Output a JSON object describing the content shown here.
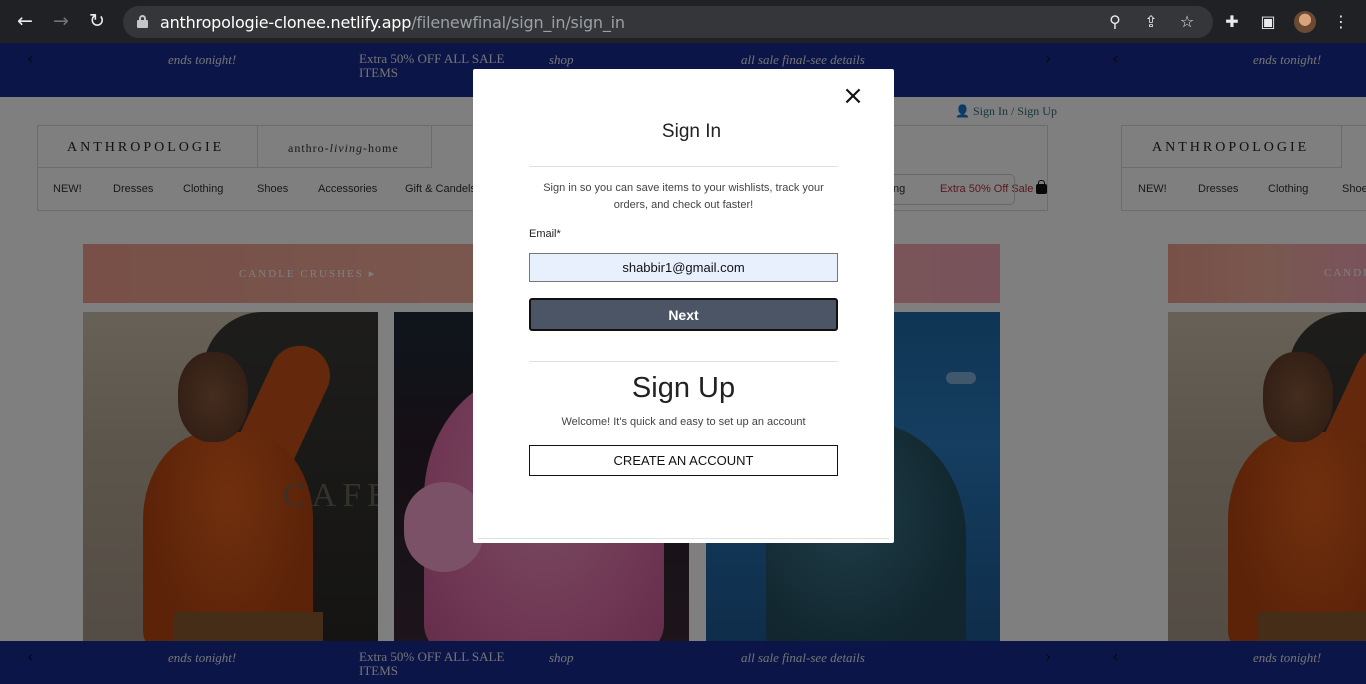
{
  "browser": {
    "url_host": "anthropologie-clonee.netlify.app",
    "url_path": "/filenewfinal/sign_in/sign_in",
    "icons": [
      "back-icon",
      "forward-icon",
      "reload-icon",
      "lock-icon",
      "zoom-icon",
      "share-icon",
      "star-icon",
      "extensions-icon",
      "sidepanel-icon",
      "profile-avatar",
      "menu-icon"
    ]
  },
  "promo": {
    "left_arrow": "‹",
    "right_arrow": "›",
    "messages": [
      "ends tonight!",
      "Extra 50% OFF ALL SALE ITEMS",
      "shop",
      "all sale final-see details"
    ],
    "color": "#182b8e"
  },
  "header": {
    "signin_link": "Sign In / Sign Up",
    "brand": "ANTHROPOLOGIE",
    "home_brand_left": "anthro-",
    "home_brand_mid": "living",
    "home_brand_right": "-home",
    "categories": [
      "NEW!",
      "Dresses",
      "Clothing",
      "Shoes",
      "Accessories",
      "Gift & Candels"
    ],
    "categories_right": [
      "ng",
      "Extra 50% Off Sale"
    ]
  },
  "banner": {
    "text": "CANDLE CRUSHES  ▸",
    "text_clipped": "CANDL"
  },
  "photos": {
    "cafe_text": "CAFE"
  },
  "modal": {
    "close": "×",
    "title": "Sign In",
    "subtitle": "Sign in so you can save items to your wishlists, track your orders, and check out faster!",
    "email_label": "Email*",
    "email_value": "shabbir1@gmail.com",
    "next_label": "Next",
    "signup_title": "Sign Up",
    "signup_subtitle": "Welcome! It's quick and easy to set up an account",
    "create_label": "CREATE AN ACCOUNT"
  }
}
